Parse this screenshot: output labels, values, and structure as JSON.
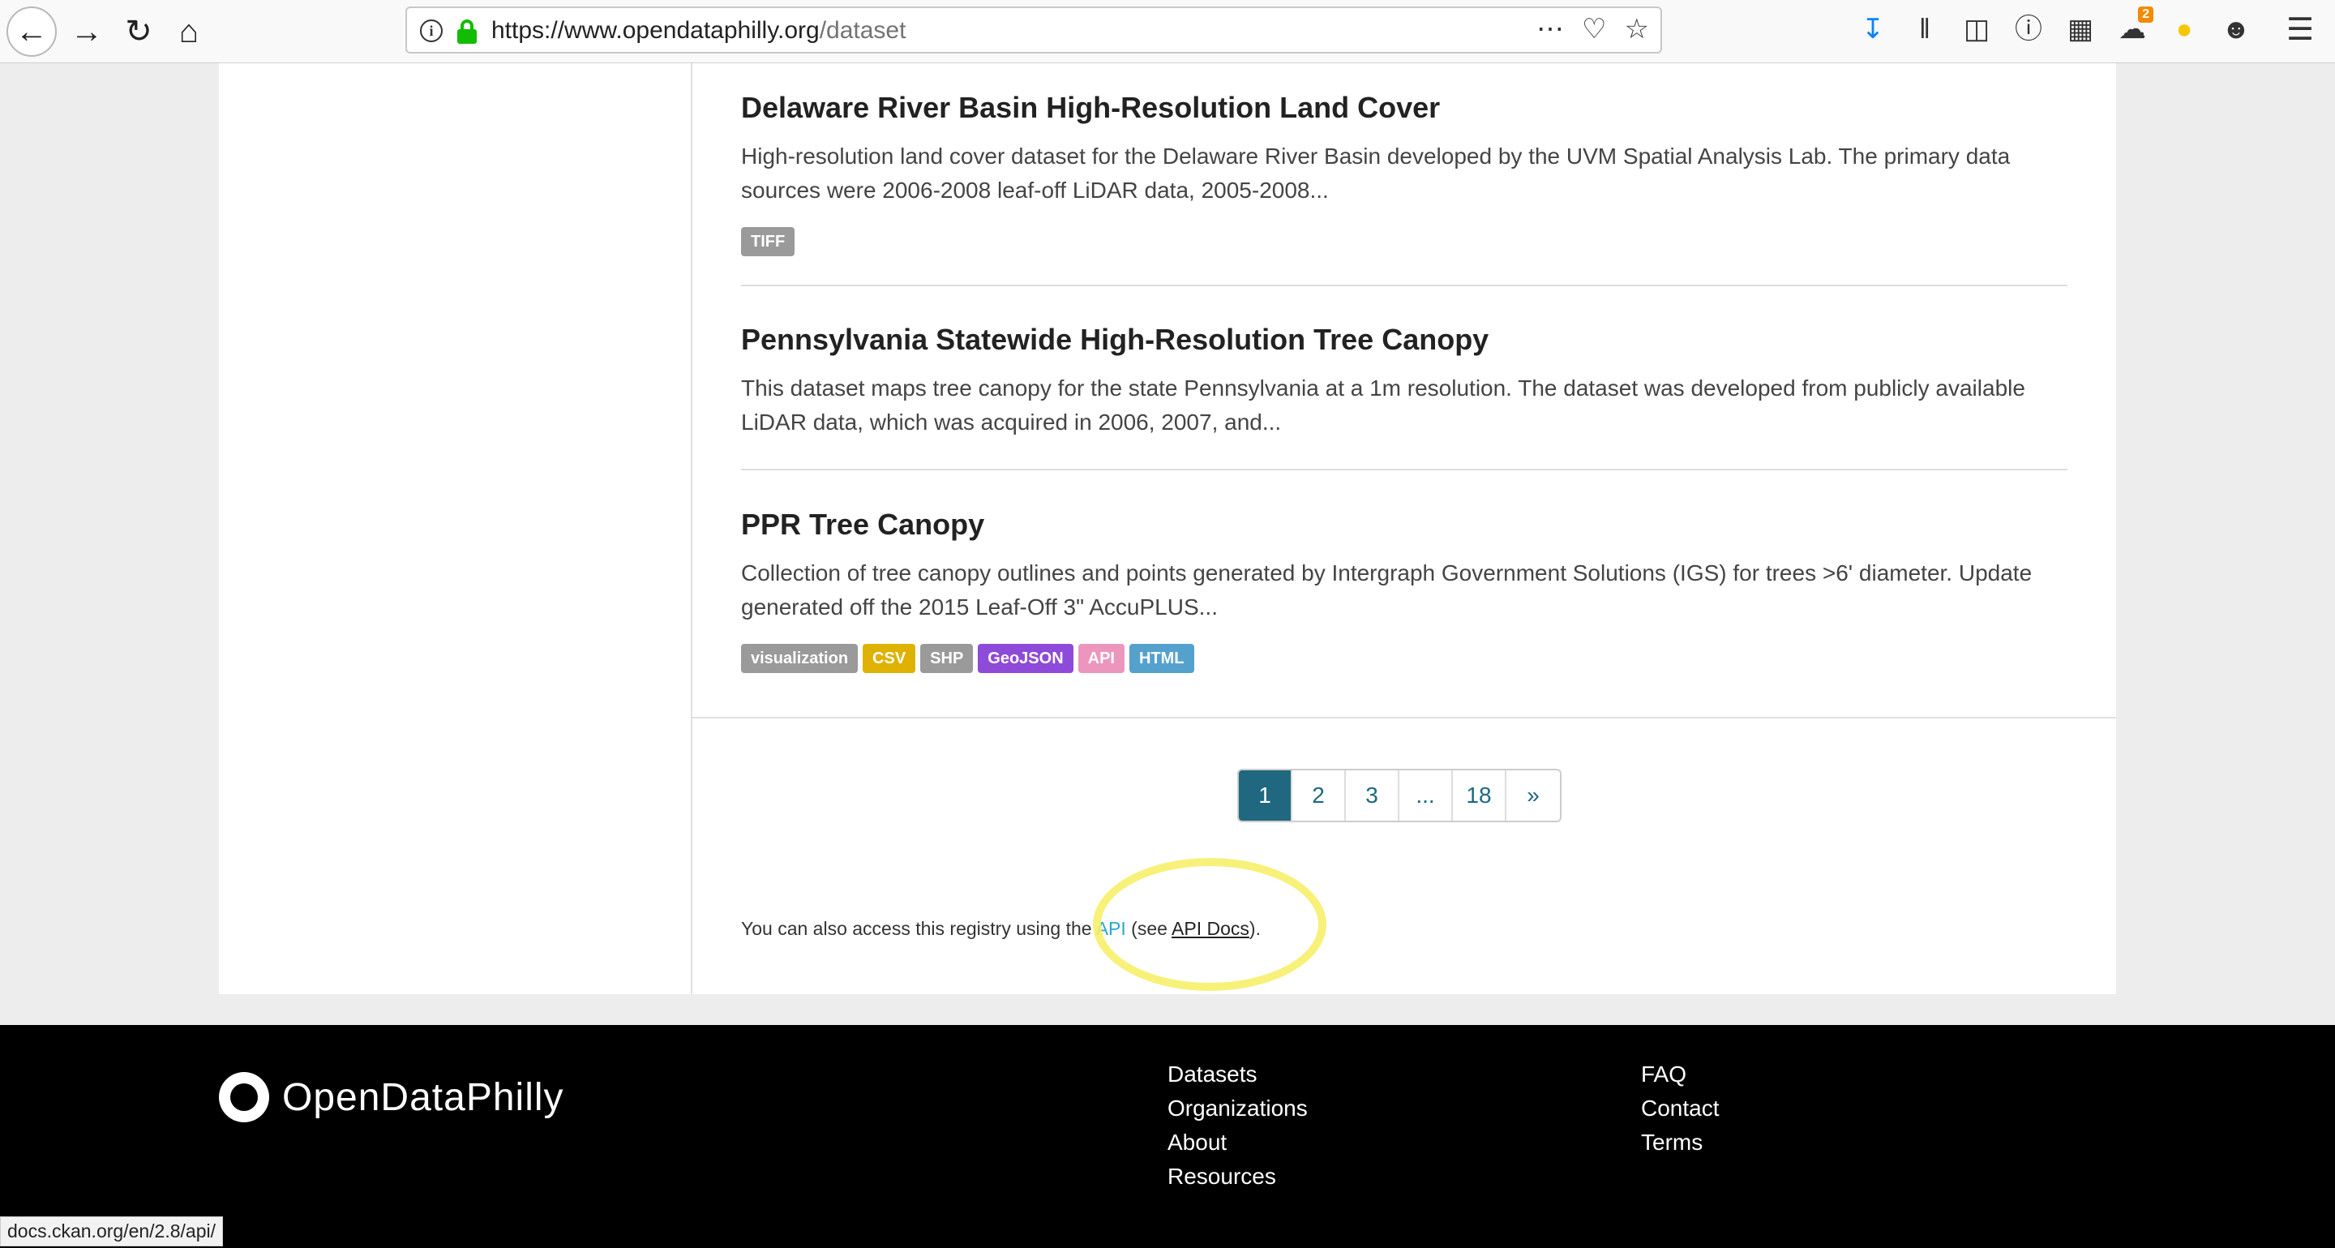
{
  "browser": {
    "url_host": "https://www.opendataphilly.org",
    "url_path": "/dataset",
    "notification_count": "2",
    "status_url": "docs.ckan.org/en/2.8/api/"
  },
  "datasets": [
    {
      "title": "Delaware River Basin High-Resolution Land Cover",
      "description": "High-resolution land cover dataset for the Delaware River Basin developed by the UVM Spatial Analysis Lab. The primary data sources were 2006-2008 leaf-off LiDAR data, 2005-2008...",
      "tags": [
        {
          "label": "TIFF",
          "color": "#9a9a9a"
        }
      ]
    },
    {
      "title": "Pennsylvania Statewide High-Resolution Tree Canopy",
      "description": "This dataset maps tree canopy for the state Pennsylvania at a 1m resolution. The dataset was developed from publicly available LiDAR data, which was acquired in 2006, 2007, and...",
      "tags": []
    },
    {
      "title": "PPR Tree Canopy",
      "description": "Collection of tree canopy outlines and points generated by Intergraph Government Solutions (IGS) for trees >6' diameter. Update generated off the 2015 Leaf-Off 3\" AccuPLUS...",
      "tags": [
        {
          "label": "visualization",
          "color": "#9a9a9a"
        },
        {
          "label": "CSV",
          "color": "#dfb100"
        },
        {
          "label": "SHP",
          "color": "#9a9a9a"
        },
        {
          "label": "GeoJSON",
          "color": "#8e4ad8"
        },
        {
          "label": "API",
          "color": "#ec96be"
        },
        {
          "label": "HTML",
          "color": "#55a1ce"
        }
      ]
    }
  ],
  "pagination": {
    "pages": [
      "1",
      "2",
      "3",
      "...",
      "18",
      "»"
    ],
    "active": "1"
  },
  "api_note": {
    "prefix": "You can also access this registry using the ",
    "api_link": "API",
    "middle": " (see ",
    "docs_link": "API Docs",
    "suffix": ")."
  },
  "footer": {
    "logo": "OpenDataPhilly",
    "col1": [
      "Datasets",
      "Organizations",
      "About",
      "Resources"
    ],
    "col2": [
      "FAQ",
      "Contact",
      "Terms"
    ]
  }
}
